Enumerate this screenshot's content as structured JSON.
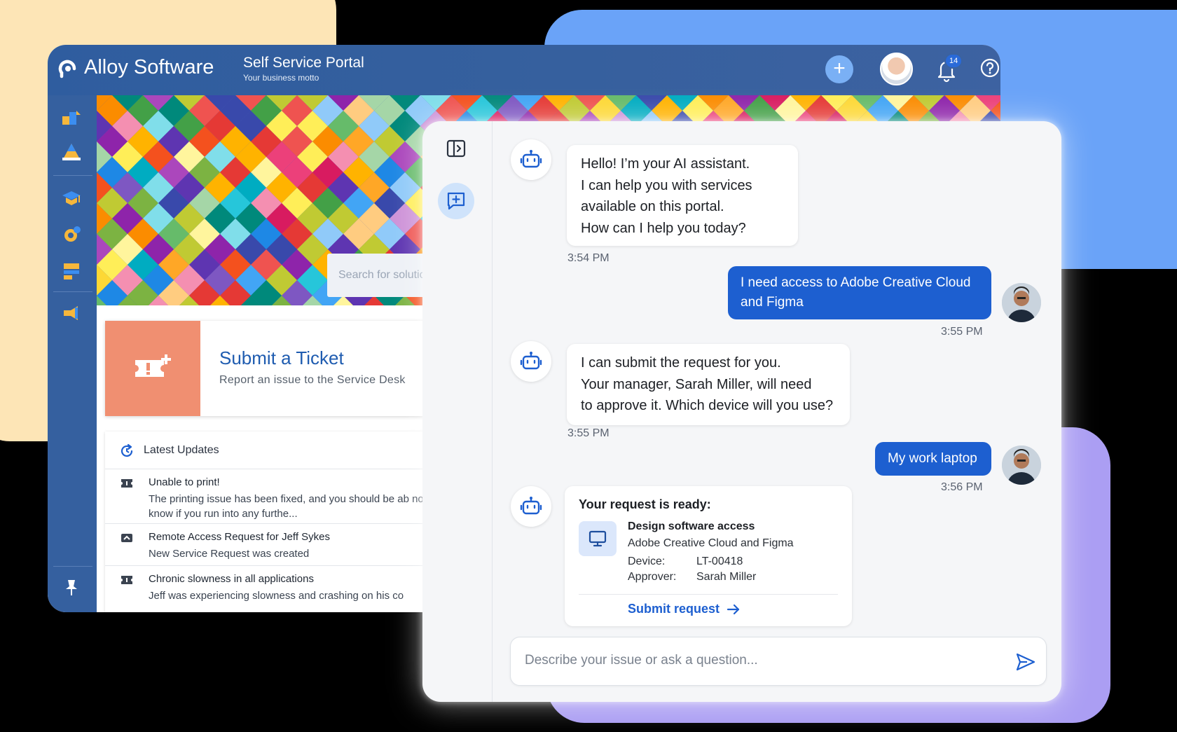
{
  "portal": {
    "brand": "Alloy Software",
    "title": "Self Service Portal",
    "motto": "Your business motto",
    "notification_count": "14",
    "search_placeholder": "Search for solutions, se",
    "ticket": {
      "title": "Submit a Ticket",
      "subtitle": "Report an issue to the Service Desk"
    },
    "updates": {
      "heading": "Latest Updates",
      "items": [
        {
          "title": "Unable to print!",
          "text": "The printing issue has been fixed, and you should be ab now. Please let us know if you run into any furthe..."
        },
        {
          "title": "Remote Access Request for Jeff Sykes",
          "text": "New Service Request was created"
        },
        {
          "title": "Chronic slowness in all applications",
          "text": "Jeff was experiencing slowness and crashing on his co"
        }
      ]
    }
  },
  "chat": {
    "messages": [
      {
        "from": "bot",
        "lines": [
          "Hello! I’m your AI assistant.",
          "I can help you with services",
          "available on this portal.",
          "How can I help you today?"
        ],
        "time": "3:54 PM"
      },
      {
        "from": "user",
        "lines": [
          "I need access to Adobe Creative Cloud",
          "and Figma"
        ],
        "time": "3:55 PM"
      },
      {
        "from": "bot",
        "lines": [
          "I can submit the request for you.",
          "Your manager, Sarah Miller, will need",
          "to approve it. Which device will you use?"
        ],
        "time": "3:55 PM"
      },
      {
        "from": "user",
        "lines": [
          "My work laptop"
        ],
        "time": "3:56 PM"
      }
    ],
    "request": {
      "title": "Your request is ready:",
      "name": "Design software access",
      "description": "Adobe Creative Cloud and Figma",
      "device_label": "Device:",
      "device_value": "LT-00418",
      "approver_label": "Approver:",
      "approver_value": "Sarah Miller",
      "submit_label": "Submit request"
    },
    "input_placeholder": "Describe your issue or ask a question..."
  },
  "colors": {
    "portal_header": "#35609f",
    "chat_user_bubble": "#1d5fd0",
    "ticket_tile": "#f08f71",
    "accent_link": "#1d5fd0"
  },
  "icons": [
    "logo-icon",
    "plus-icon",
    "bell-icon",
    "help-icon",
    "sidebar-icons",
    "ticket-icon",
    "refresh-icon",
    "robot-icon",
    "monitor-icon",
    "arrow-right-icon",
    "send-icon",
    "sidebar-toggle-icon",
    "new-chat-icon",
    "pin-icon"
  ]
}
